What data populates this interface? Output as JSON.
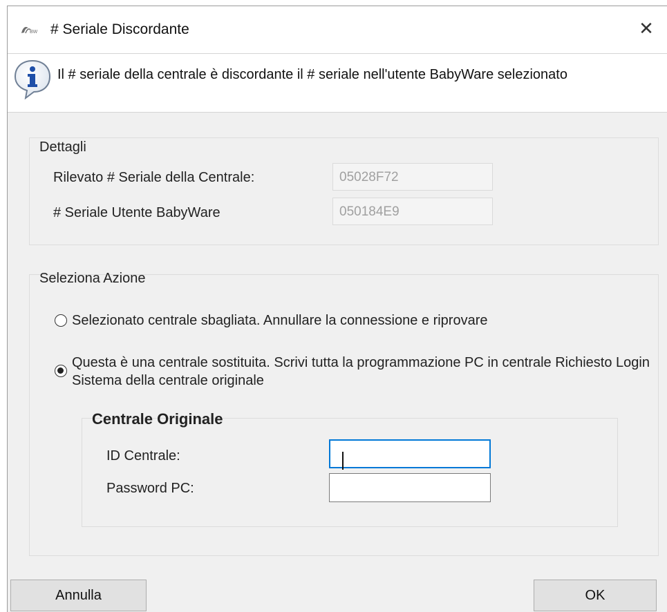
{
  "window": {
    "title": "# Seriale Discordante",
    "close_label": "✕"
  },
  "banner": {
    "icon": "info-icon",
    "message": "Il # seriale della centrale è discordante il # seriale nell'utente BabyWare selezionato"
  },
  "details": {
    "group_title": "Dettagli",
    "detected_serial_label": "Rilevato  # Seriale della Centrale:",
    "detected_serial_value": "05028F72",
    "user_serial_label": "# Seriale Utente BabyWare",
    "user_serial_value": "050184E9"
  },
  "action": {
    "group_title": "Seleziona Azione",
    "options": [
      {
        "label": "Selezionato centrale sbagliata. Annullare la connessione e riprovare",
        "checked": false
      },
      {
        "label": "Questa è una centrale sostituita. Scrivi tutta la programmazione PC in centrale Richiesto Login Sistema della centrale originale",
        "checked": true
      }
    ]
  },
  "original_panel": {
    "title": "Centrale Originale",
    "id_label": "ID Centrale:",
    "id_value": "",
    "password_label": "Password PC:",
    "password_value": ""
  },
  "buttons": {
    "cancel": "Annulla",
    "ok": "OK"
  },
  "colors": {
    "dialog_background": "#f0f0f0",
    "focus_border": "#0078d7",
    "info_icon": "#1f4fa8"
  }
}
